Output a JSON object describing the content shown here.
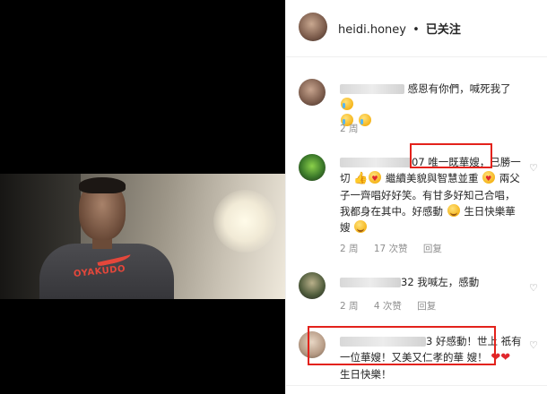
{
  "header": {
    "username": "heidi.honey",
    "separator": "•",
    "follow_label": "已关注"
  },
  "comments": [
    {
      "text": "感恩有你們，喊死我了",
      "time": "2 周"
    },
    {
      "handle_suffix": "07",
      "text_highlight": "唯一既華嫂",
      "text_1": "，已勝一切",
      "text_2": "繼續美貌與智慧並重",
      "text_3": "兩父子一齊唱好好笑。有甘多好知己合唱，我都身在其中。好感動",
      "text_4": "生日快樂華嫂",
      "time": "2 周",
      "likes": "17 次赞",
      "reply": "回复"
    },
    {
      "handle_suffix": "32",
      "text": "我喊左，感動",
      "time": "2 周",
      "likes": "4 次赞",
      "reply": "回复"
    },
    {
      "handle_suffix": "3",
      "text_1": "好感動！世上",
      "text_2": "祇有一位華嫂！又美又仁孝的華",
      "text_3": "嫂！",
      "text_4": "生日快樂！"
    }
  ],
  "video": {
    "shirt_text": "OYAKUDO"
  }
}
